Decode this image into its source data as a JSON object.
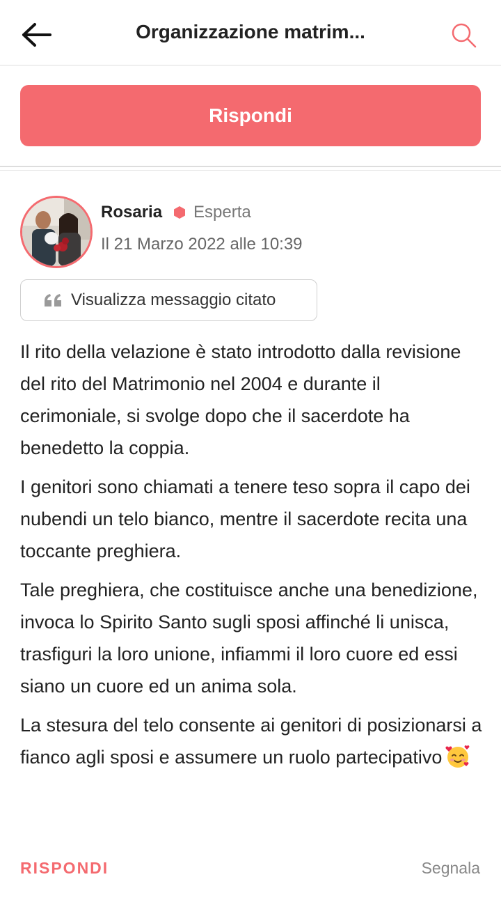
{
  "header": {
    "title": "Organizzazione matrim...",
    "back_icon": "arrow-left-icon",
    "search_icon": "search-icon"
  },
  "actions": {
    "reply_button_label": "Rispondi"
  },
  "post": {
    "author": {
      "name": "Rosaria",
      "badge": "Esperta",
      "badge_color": "#f46a6f"
    },
    "date": "Il 21 Marzo 2022 alle 10:39",
    "quote_button_label": "Visualizza messaggio citato",
    "paragraphs": [
      "Il rito della velazione è stato introdotto dalla revisione del rito del Matrimonio nel 2004 e durante il cerimoniale, si svolge dopo che il sacerdote ha benedetto la coppia.",
      "I genitori sono chiamati a tenere teso sopra il capo dei nubendi un telo bianco, mentre il sacerdote recita una toccante preghiera.",
      "Tale preghiera, che costituisce anche una benedizione, invoca lo Spirito Santo sugli sposi affinché li unisca, trasfiguri la loro unione, infiammi il loro cuore ed essi siano un cuore ed un anima sola.",
      "La stesura del telo consente ai genitori di posizionarsi a fianco agli sposi e assumere un ruolo partecipativo"
    ],
    "emoji_icon": "smiling-face-with-hearts-icon",
    "footer": {
      "reply_label": "RISPONDI",
      "report_label": "Segnala"
    }
  },
  "colors": {
    "accent": "#f46a6f",
    "text": "#222222",
    "muted": "#777777"
  }
}
